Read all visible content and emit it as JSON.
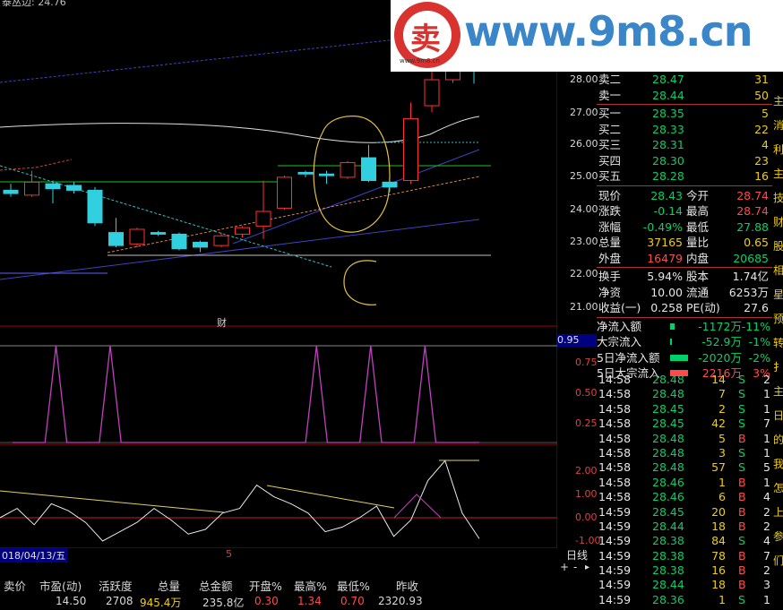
{
  "header": {
    "partial_text": "泰丛边: 24.76"
  },
  "watermark": {
    "site": "www.9m8.cn",
    "small": "www.9m8.cn",
    "logo_char": "卖"
  },
  "price_axis": [
    "28.00",
    "27.00",
    "26.00",
    "25.00",
    "24.00",
    "23.00",
    "22.00",
    "21.00"
  ],
  "indicator1": {
    "label": "财",
    "axis": [
      "0.95",
      "0.75",
      "0.50",
      "0.25"
    ]
  },
  "indicator2": {
    "axis": [
      "2.00",
      "1.00",
      "0.00",
      "-1.00"
    ]
  },
  "date_bar": {
    "date": "018/04/13/五",
    "mid": "5",
    "period": "日线",
    "plus": "+",
    "minus": "-"
  },
  "order_book": [
    {
      "label": "卖二",
      "price": "28.47",
      "vol": "31"
    },
    {
      "label": "卖一",
      "price": "28.44",
      "vol": "50"
    },
    {
      "label": "买一",
      "price": "28.35",
      "vol": "5"
    },
    {
      "label": "买二",
      "price": "28.33",
      "vol": "22"
    },
    {
      "label": "买三",
      "price": "28.31",
      "vol": "4"
    },
    {
      "label": "买四",
      "price": "28.30",
      "vol": "23"
    },
    {
      "label": "买五",
      "price": "28.28",
      "vol": "16"
    }
  ],
  "stats": [
    {
      "l1": "现价",
      "v1": "28.43",
      "l2": "今开",
      "v2": "28.74"
    },
    {
      "l1": "涨跌",
      "v1": "-0.14",
      "l2": "最高",
      "v2": "28.74"
    },
    {
      "l1": "涨幅",
      "v1": "-0.49%",
      "l2": "最低",
      "v2": "27.88"
    },
    {
      "l1": "总量",
      "v1": "37165",
      "l2": "量比",
      "v2": "0.65"
    },
    {
      "l1": "外盘",
      "v1": "16479",
      "l2": "内盘",
      "v2": "20685"
    },
    {
      "l1": "换手",
      "v1": "5.94%",
      "l2": "股本",
      "v2": "1.74亿"
    },
    {
      "l1": "净资",
      "v1": "10.00",
      "l2": "流通",
      "v2": "6253万"
    },
    {
      "l1": "收益(一)",
      "v1": "0.258",
      "l2": "PE(动)",
      "v2": "27.6"
    }
  ],
  "flows": [
    {
      "label": "净流入额",
      "value": "-1172万",
      "pct": "-11%",
      "bar": 0.12,
      "color": "#00d26a"
    },
    {
      "label": "大宗流入",
      "value": "-52.9万",
      "pct": "-1%",
      "bar": 0.01,
      "color": "#00d26a"
    },
    {
      "label": "5日净流入额",
      "value": "-2020万",
      "pct": "-2%",
      "bar": 0.45,
      "color": "#00d26a"
    },
    {
      "label": "5日大宗流入",
      "value": "2216万",
      "pct": "3%",
      "bar": 0.45,
      "color": "#ff4a4a"
    }
  ],
  "ticks": [
    {
      "t": "14:58",
      "p": "28.48",
      "v": "14",
      "s": "S",
      "n": "2"
    },
    {
      "t": "14:58",
      "p": "28.48",
      "v": "7",
      "s": "S",
      "n": "1"
    },
    {
      "t": "14:58",
      "p": "28.45",
      "v": "2",
      "s": "S",
      "n": "1"
    },
    {
      "t": "14:58",
      "p": "28.45",
      "v": "42",
      "s": "S",
      "n": "7"
    },
    {
      "t": "14:58",
      "p": "28.48",
      "v": "5",
      "s": "B",
      "n": "1"
    },
    {
      "t": "14:58",
      "p": "28.48",
      "v": "3",
      "s": "S",
      "n": "1"
    },
    {
      "t": "14:58",
      "p": "28.48",
      "v": "57",
      "s": "S",
      "n": "5"
    },
    {
      "t": "14:58",
      "p": "28.46",
      "v": "1",
      "s": "B",
      "n": "1"
    },
    {
      "t": "14:58",
      "p": "28.46",
      "v": "6",
      "s": "B",
      "n": "4"
    },
    {
      "t": "14:59",
      "p": "28.45",
      "v": "20",
      "s": "B",
      "n": "2"
    },
    {
      "t": "14:59",
      "p": "28.44",
      "v": "18",
      "s": "B",
      "n": "2"
    },
    {
      "t": "14:59",
      "p": "28.38",
      "v": "84",
      "s": "S",
      "n": "4"
    },
    {
      "t": "14:59",
      "p": "28.38",
      "v": "78",
      "s": "B",
      "n": "7"
    },
    {
      "t": "14:59",
      "p": "28.38",
      "v": "16",
      "s": "B",
      "n": "2"
    },
    {
      "t": "14:59",
      "p": "28.44",
      "v": "18",
      "s": "B",
      "n": "3"
    },
    {
      "t": "14:59",
      "p": "28.36",
      "v": "1",
      "s": "S",
      "n": "1"
    }
  ],
  "bottom": {
    "headers": [
      "卖价",
      "市盈(动)",
      "活跃度",
      "总量",
      "总金额",
      "开盘%",
      "最高%",
      "最低%",
      "昨收"
    ],
    "values": [
      "14.50",
      "2708",
      "945.4万",
      "235.8亿",
      "0.30",
      "1.34",
      "0.70",
      "2320.93"
    ]
  },
  "edge_chars": [
    "主",
    "消",
    "利",
    "主",
    "技",
    "财",
    "股",
    "相",
    "星",
    "预",
    "转",
    "扌",
    "主",
    "日",
    "的",
    "我",
    "怎",
    "上",
    "参",
    "们"
  ],
  "chart_data": [
    {
      "type": "candlestick",
      "title": "",
      "ylim": [
        21.0,
        28.5
      ],
      "y_ticks": [
        28,
        27,
        26,
        25,
        24,
        23,
        22,
        21
      ],
      "candles": [
        {
          "o": 24.6,
          "c": 24.5,
          "h": 24.8,
          "l": 24.4
        },
        {
          "o": 24.45,
          "c": 24.85,
          "h": 25.2,
          "l": 24.4
        },
        {
          "o": 24.8,
          "c": 24.65,
          "h": 24.9,
          "l": 24.2
        },
        {
          "o": 24.75,
          "c": 24.6,
          "h": 24.85,
          "l": 24.5
        },
        {
          "o": 24.6,
          "c": 23.6,
          "h": 24.7,
          "l": 23.5
        },
        {
          "o": 23.3,
          "c": 22.9,
          "h": 23.75,
          "l": 22.85
        },
        {
          "o": 22.95,
          "c": 23.4,
          "h": 23.45,
          "l": 22.85
        },
        {
          "o": 23.3,
          "c": 23.25,
          "h": 23.35,
          "l": 23.2
        },
        {
          "o": 23.25,
          "c": 22.8,
          "h": 23.3,
          "l": 22.75
        },
        {
          "o": 23.0,
          "c": 22.85,
          "h": 23.05,
          "l": 22.7
        },
        {
          "o": 22.9,
          "c": 23.2,
          "h": 23.3,
          "l": 22.85
        },
        {
          "o": 23.25,
          "c": 23.45,
          "h": 23.5,
          "l": 23.15
        },
        {
          "o": 23.5,
          "c": 23.95,
          "h": 24.9,
          "l": 23.1
        },
        {
          "o": 24.05,
          "c": 25.0,
          "h": 25.05,
          "l": 24.0
        },
        {
          "o": 25.15,
          "c": 25.1,
          "h": 25.2,
          "l": 25.0
        },
        {
          "o": 25.1,
          "c": 25.05,
          "h": 25.2,
          "l": 24.8
        },
        {
          "o": 25.0,
          "c": 25.45,
          "h": 25.5,
          "l": 24.95
        },
        {
          "o": 25.6,
          "c": 24.9,
          "h": 26.0,
          "l": 24.85
        },
        {
          "o": 24.85,
          "c": 24.7,
          "h": 24.9,
          "l": 24.55
        },
        {
          "o": 24.9,
          "c": 26.8,
          "h": 27.3,
          "l": 24.8
        },
        {
          "o": 27.2,
          "c": 28.0,
          "h": 28.6,
          "l": 27.0
        },
        {
          "o": 28.0,
          "c": 28.3,
          "h": 28.6,
          "l": 27.9
        },
        {
          "o": 28.74,
          "c": 28.43,
          "h": 28.74,
          "l": 27.88
        }
      ]
    },
    {
      "type": "line",
      "title": "财",
      "ylim": [
        0,
        1.0
      ],
      "series": [
        {
          "values": [
            0,
            0,
            0,
            0,
            0.95,
            0,
            0,
            0,
            0,
            0.95,
            0,
            0,
            0,
            0,
            0,
            0,
            0,
            0,
            0,
            0,
            0,
            0,
            0,
            0,
            0,
            0,
            0,
            0,
            0.95,
            0,
            0,
            0,
            0,
            0.95,
            0,
            0,
            0,
            0,
            0.95,
            0,
            0,
            0,
            0,
            0
          ]
        }
      ]
    },
    {
      "type": "line",
      "ylim": [
        -1.3,
        2.6
      ],
      "series": [
        {
          "values": [
            0.0,
            0.4,
            -0.3,
            0.6,
            0.3,
            -0.2,
            -1.0,
            -0.6,
            -0.2,
            0.4,
            -0.1,
            -0.7,
            -0.5,
            0.2,
            0.4,
            1.4,
            0.9,
            0.6,
            0.2,
            -0.6,
            -0.4,
            0.0,
            0.5,
            -0.8,
            -0.1,
            1.6,
            2.45,
            0.2,
            -0.9
          ]
        }
      ]
    }
  ]
}
